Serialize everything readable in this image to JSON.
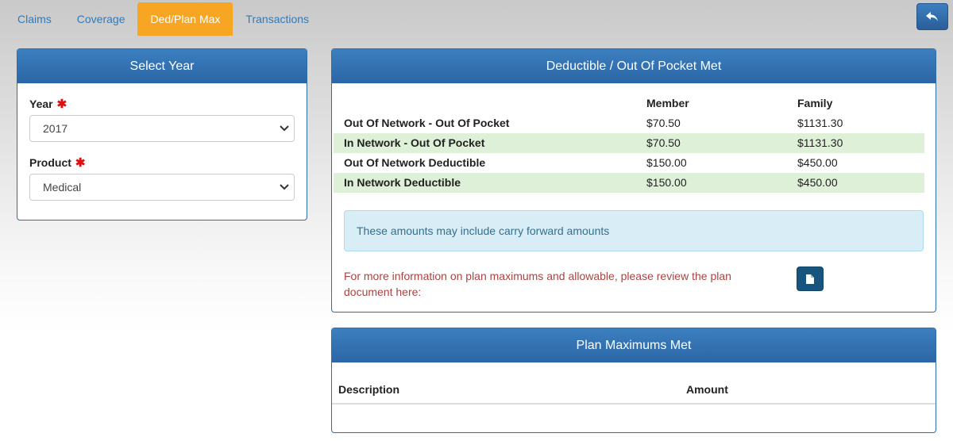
{
  "tabs": [
    {
      "label": "Claims",
      "active": false
    },
    {
      "label": "Coverage",
      "active": false
    },
    {
      "label": "Ded/Plan Max",
      "active": true
    },
    {
      "label": "Transactions",
      "active": false
    }
  ],
  "back_button": {
    "icon": "reply-arrow-icon"
  },
  "select_year": {
    "title": "Select Year",
    "year": {
      "label": "Year",
      "required_mark": "✱",
      "value": "2017"
    },
    "product": {
      "label": "Product",
      "required_mark": "✱",
      "value": "Medical"
    }
  },
  "deductible": {
    "title": "Deductible / Out Of Pocket Met",
    "columns": {
      "member": "Member",
      "family": "Family"
    },
    "rows": [
      {
        "label": "Out Of Network - Out Of Pocket",
        "member": "$70.50",
        "family": "$1131.30"
      },
      {
        "label": "In Network - Out Of Pocket",
        "member": "$70.50",
        "family": "$1131.30"
      },
      {
        "label": "Out Of Network Deductible",
        "member": "$150.00",
        "family": "$450.00"
      },
      {
        "label": "In Network Deductible",
        "member": "$150.00",
        "family": "$450.00"
      }
    ],
    "info_text": "These amounts may include carry forward amounts",
    "plan_note": "For more information on plan maximums and allowable, please review the plan document here:",
    "doc_button_icon": "document-icon"
  },
  "plan_max": {
    "title": "Plan Maximums Met",
    "columns": {
      "description": "Description",
      "amount": "Amount"
    }
  },
  "colors": {
    "accent": "#2b66a6",
    "active_tab": "#f6a623",
    "alt_row": "#dff0d8",
    "info_bg": "#d9edf7",
    "note_text": "#a94442",
    "required": "#e01010"
  }
}
